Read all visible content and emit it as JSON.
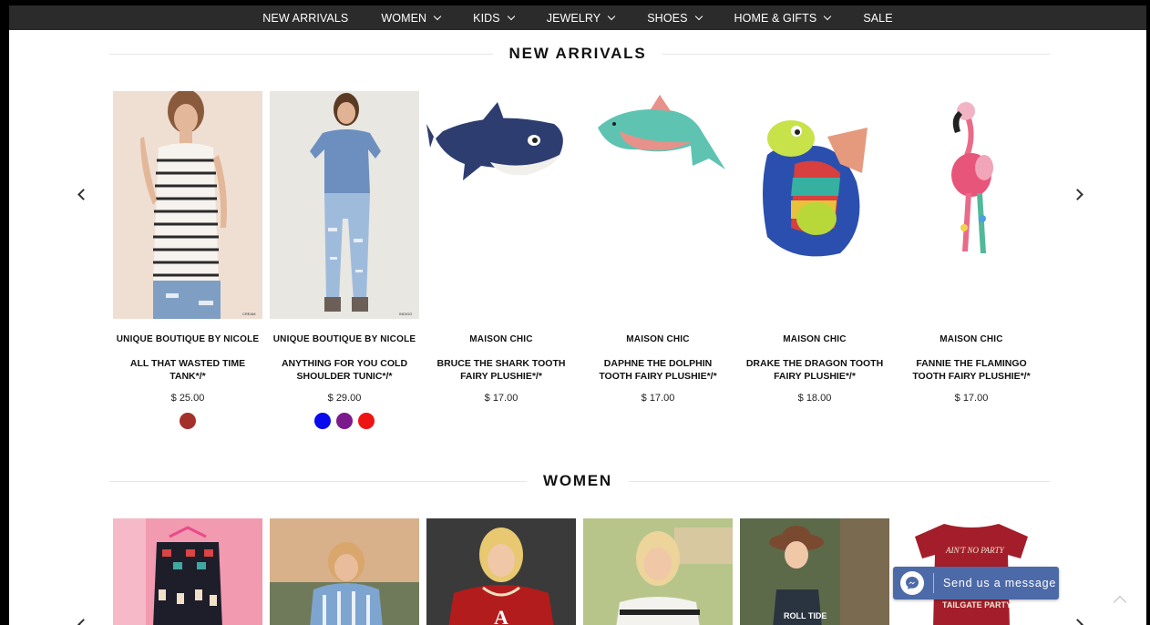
{
  "nav": {
    "items": [
      {
        "label": "NEW ARRIVALS",
        "dropdown": false
      },
      {
        "label": "WOMEN",
        "dropdown": true
      },
      {
        "label": "KIDS",
        "dropdown": true
      },
      {
        "label": "JEWELRY",
        "dropdown": true
      },
      {
        "label": "SHOES",
        "dropdown": true
      },
      {
        "label": "HOME & GIFTS",
        "dropdown": true
      },
      {
        "label": "SALE",
        "dropdown": false
      }
    ]
  },
  "sections": {
    "new_arrivals": {
      "title": "NEW ARRIVALS",
      "products": [
        {
          "brand": "UNIQUE BOUTIQUE BY NICOLE",
          "name": "ALL THAT WASTED TIME TANK*/*",
          "price": "$ 25.00",
          "swatches": [
            "#a4302a"
          ],
          "image_tag": "CREAM"
        },
        {
          "brand": "UNIQUE BOUTIQUE BY NICOLE",
          "name": "ANYTHING FOR YOU COLD SHOULDER TUNIC*/*",
          "price": "$ 29.00",
          "swatches": [
            "#0a0aee",
            "#7b1a8c",
            "#ef1414"
          ],
          "image_tag": "INDIGO"
        },
        {
          "brand": "MAISON CHIC",
          "name": "BRUCE THE SHARK TOOTH FAIRY PLUSHIE*/*",
          "price": "$ 17.00",
          "swatches": []
        },
        {
          "brand": "MAISON CHIC",
          "name": "DAPHNE THE DOLPHIN TOOTH FAIRY PLUSHIE*/*",
          "price": "$ 17.00",
          "swatches": []
        },
        {
          "brand": "MAISON CHIC",
          "name": "DRAKE THE DRAGON TOOTH FAIRY PLUSHIE*/*",
          "price": "$ 18.00",
          "swatches": []
        },
        {
          "brand": "MAISON CHIC",
          "name": "FANNIE THE FLAMINGO TOOTH FAIRY PLUSHIE*/*",
          "price": "$ 17.00",
          "swatches": []
        }
      ]
    },
    "women": {
      "title": "WOMEN",
      "image_texts": {
        "tee_top": "AIN'T NO PARTY",
        "tee_bottom": "TAILGATE PARTY",
        "tank": "ROLL TIDE"
      }
    }
  },
  "messenger": {
    "label": "Send us a message"
  },
  "icons": {
    "prev": "chevron-left-icon",
    "next": "chevron-right-icon",
    "messenger": "messenger-icon",
    "scroll_top": "chevron-up-icon"
  }
}
